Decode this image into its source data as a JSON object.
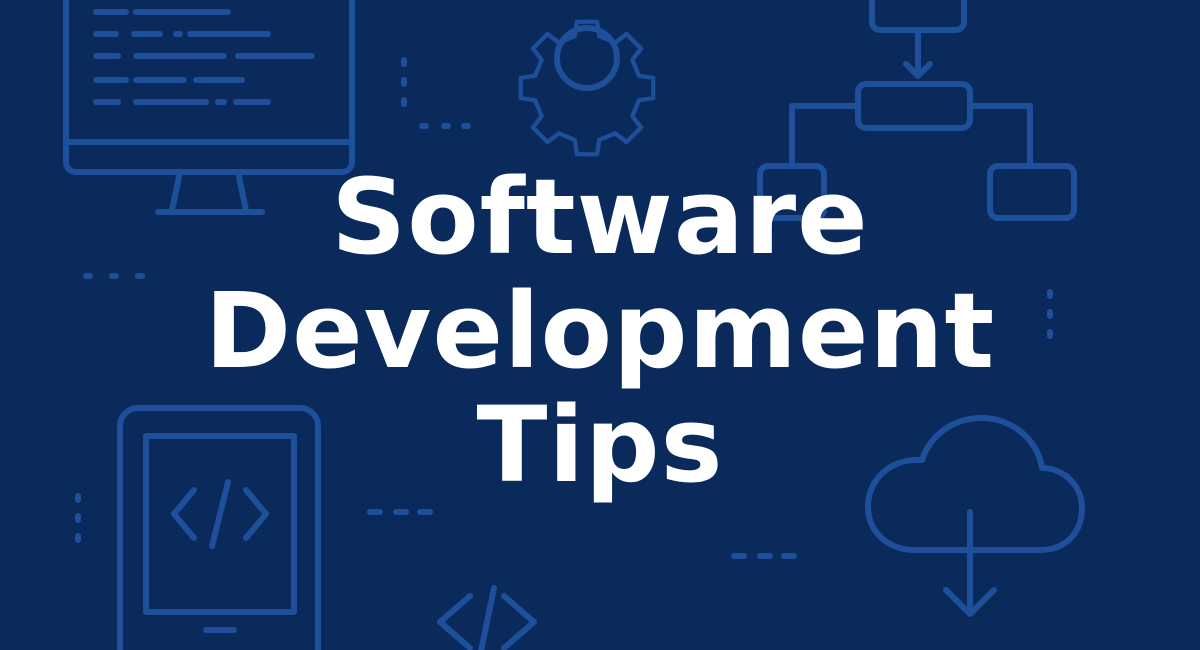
{
  "colors": {
    "background": "#0a2a5c",
    "icon_line": "#1d4f9a",
    "headline": "#ffffff"
  },
  "headline": {
    "line1": "Software",
    "line2": "Development",
    "line3": "Tips"
  },
  "icons": [
    "monitor-code-icon",
    "gear-icon",
    "flowchart-icon",
    "tablet-code-icon",
    "code-brackets-icon",
    "cloud-download-icon"
  ]
}
